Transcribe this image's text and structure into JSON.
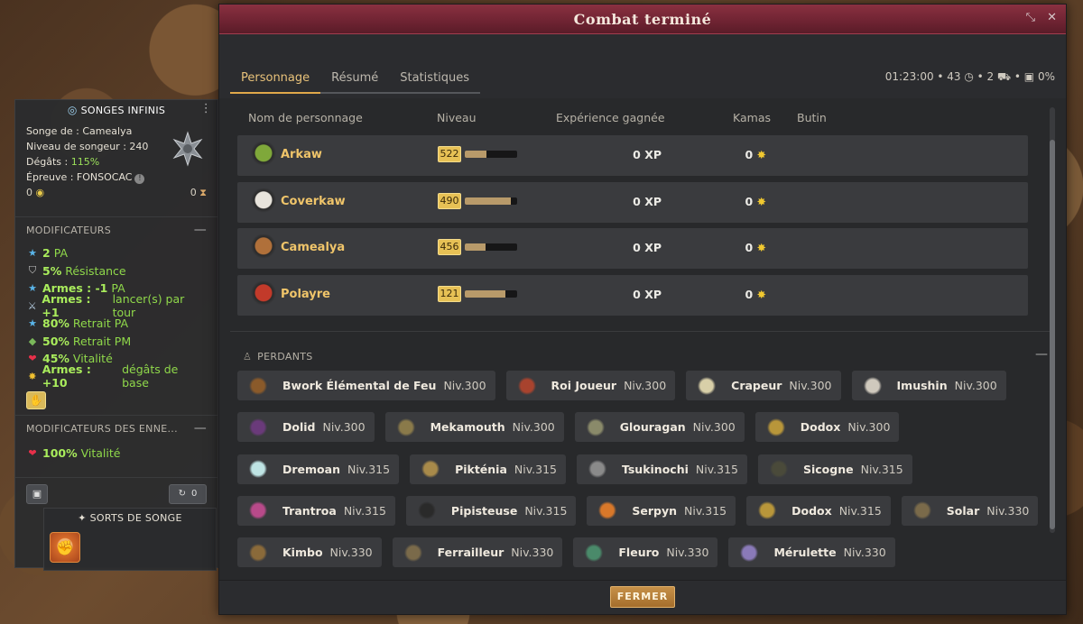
{
  "colors": {
    "accent": "#e0a84a",
    "title_bar": "#7a2838",
    "green": "#8fd84a",
    "gold": "#f0c56a"
  },
  "left_panel": {
    "title": "SONGES INFINIS",
    "songe_label": "Songe de : Camealya",
    "niveau_label": "Niveau de songeur : 240",
    "degats_label": "Dégâts : ",
    "degats_value": "115%",
    "epreuve_label": "Épreuve : FONSOCAC",
    "counter_left": "0",
    "counter_right": "0",
    "modifiers_title": "MODIFICATEURS",
    "modifiers": [
      {
        "icon": "star-icon",
        "bold": "2",
        "text": "PA"
      },
      {
        "icon": "shield-icon",
        "bold": "5%",
        "text": "Résistance"
      },
      {
        "icon": "star-icon",
        "bold": "Armes : -1",
        "text": "PA"
      },
      {
        "icon": "sword-icon",
        "bold": "Armes : +1",
        "text": "lancer(s) par tour"
      },
      {
        "icon": "star-icon",
        "bold": "80%",
        "text": "Retrait PA"
      },
      {
        "icon": "boot-icon",
        "bold": "50%",
        "text": "Retrait PM"
      },
      {
        "icon": "heart-icon",
        "bold": "45%",
        "text": "Vitalité"
      },
      {
        "icon": "burst-icon",
        "bold": "Armes : +10",
        "text": "dégâts de base"
      }
    ],
    "enemy_modifiers_title": "MODIFICATEURS DES ENNE...",
    "enemy_modifiers": [
      {
        "icon": "heart-icon",
        "bold": "100%",
        "text": "Vitalité"
      }
    ],
    "reroll_count": "0",
    "spells_title": "SORTS DE SONGE"
  },
  "dialog": {
    "title": "Combat terminé",
    "tabs": [
      "Personnage",
      "Résumé",
      "Statistiques"
    ],
    "status": "01:23:00 • 43 ◷ • 2 ⛟ • ▣ 0%",
    "columns": [
      "Nom de personnage",
      "Niveau",
      "Expérience gagnée",
      "Kamas",
      "Butin"
    ],
    "players": [
      {
        "name": "Arkaw",
        "level": "522",
        "progress": 0.42,
        "xp": "0 XP",
        "kamas": "0",
        "avatar_color": "#7fa83a"
      },
      {
        "name": "Coverkaw",
        "level": "490",
        "progress": 0.88,
        "xp": "0 XP",
        "kamas": "0",
        "avatar_color": "#e8e4dc"
      },
      {
        "name": "Camealya",
        "level": "456",
        "progress": 0.4,
        "xp": "0 XP",
        "kamas": "0",
        "avatar_color": "#b0703a"
      },
      {
        "name": "Polayre",
        "level": "121",
        "progress": 0.78,
        "xp": "0 XP",
        "kamas": "0",
        "avatar_color": "#c23a2a"
      }
    ],
    "losers_title": "PERDANTS",
    "losers": [
      [
        {
          "name": "Bwork Élémental de Feu",
          "level": "Niv.300",
          "color": "#8a5a2a"
        },
        {
          "name": "Roi Joueur",
          "level": "Niv.300",
          "color": "#a8432e"
        },
        {
          "name": "Crapeur",
          "level": "Niv.300",
          "color": "#d8cfa8"
        },
        {
          "name": "Imushin",
          "level": "Niv.300",
          "color": "#cfc9bd"
        }
      ],
      [
        {
          "name": "Dolid",
          "level": "Niv.300",
          "color": "#6a3a7a"
        },
        {
          "name": "Mekamouth",
          "level": "Niv.300",
          "color": "#8a7a4a"
        },
        {
          "name": "Glouragan",
          "level": "Niv.300",
          "color": "#8a8a6a"
        },
        {
          "name": "Dodox",
          "level": "Niv.300",
          "color": "#b8963a"
        }
      ],
      [
        {
          "name": "Dremoan",
          "level": "Niv.315",
          "color": "#bfe4e4"
        },
        {
          "name": "Pikténia",
          "level": "Niv.315",
          "color": "#a88a4a"
        },
        {
          "name": "Tsukinochi",
          "level": "Niv.315",
          "color": "#8a8a8a"
        },
        {
          "name": "Sicogne",
          "level": "Niv.315",
          "color": "#4a4a3a"
        }
      ],
      [
        {
          "name": "Trantroa",
          "level": "Niv.315",
          "color": "#b84a8a"
        },
        {
          "name": "Pipisteuse",
          "level": "Niv.315",
          "color": "#2a2a2a"
        },
        {
          "name": "Serpyn",
          "level": "Niv.315",
          "color": "#d8782a"
        },
        {
          "name": "Dodox",
          "level": "Niv.315",
          "color": "#b8963a"
        },
        {
          "name": "Solar",
          "level": "Niv.330",
          "color": "#7a6a4a"
        }
      ],
      [
        {
          "name": "Kimbo",
          "level": "Niv.330",
          "color": "#8a6a3a"
        },
        {
          "name": "Ferrailleur",
          "level": "Niv.330",
          "color": "#7a6a4a"
        },
        {
          "name": "Fleuro",
          "level": "Niv.330",
          "color": "#4a8a6a"
        },
        {
          "name": "Mérulette",
          "level": "Niv.330",
          "color": "#8a7ab8"
        }
      ]
    ],
    "close_label": "FERMER"
  }
}
